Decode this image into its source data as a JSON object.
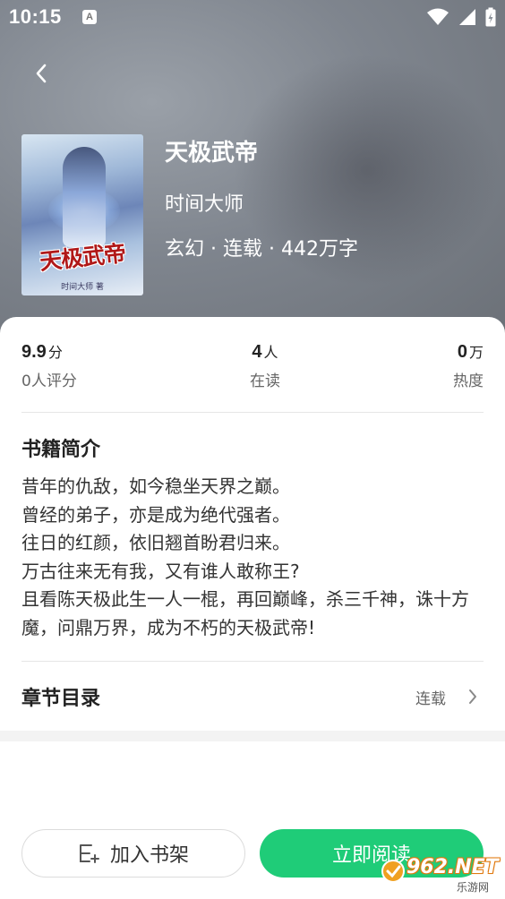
{
  "status_bar": {
    "time": "10:15",
    "notif_letter": "A"
  },
  "book": {
    "title": "天极武帝",
    "author": "时间大师",
    "meta": "玄幻 · 连载 · 442万字",
    "cover_title": "天极武帝",
    "cover_author": "时间大师 著"
  },
  "stats": {
    "rating": {
      "value": "9.9",
      "unit": "分",
      "label": "0人评分"
    },
    "reading": {
      "value": "4",
      "unit": "人",
      "label": "在读"
    },
    "heat": {
      "value": "0",
      "unit": "万",
      "label": "热度"
    }
  },
  "intro": {
    "title": "书籍简介",
    "lines": [
      "昔年的仇敌，如今稳坐天界之巅。",
      "曾经的弟子，亦是成为绝代强者。",
      "往日的红颜，依旧翘首盼君归来。",
      "万古往来无有我，又有谁人敢称王?",
      "且看陈天极此生一人一棍，再回巅峰，杀三千神，诛十方魔，问鼎万界，成为不朽的天极武帝!"
    ]
  },
  "toc": {
    "title": "章节目录",
    "status": "连载"
  },
  "actions": {
    "add_shelf": "加入书架",
    "read_now": "立即阅读"
  },
  "watermark": {
    "logo": "962.NET",
    "sub": "乐游网"
  },
  "colors": {
    "accent": "#1fcc78",
    "hero": "#7f858e",
    "cover_title": "#b01818"
  },
  "icons": [
    "back-arrow-icon",
    "wifi-icon",
    "signal-icon",
    "battery-icon",
    "add-bookshelf-icon",
    "chevron-right-icon"
  ]
}
